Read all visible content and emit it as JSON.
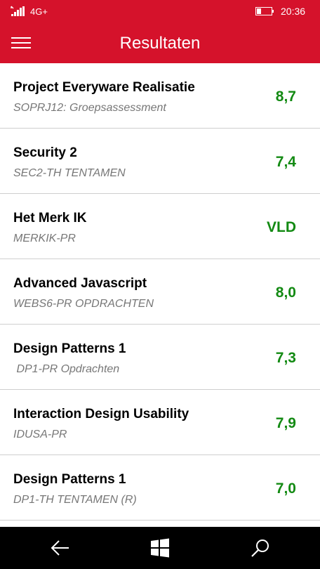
{
  "statusbar": {
    "network": "4G+",
    "time": "20:36"
  },
  "appbar": {
    "title": "Resultaten"
  },
  "results": [
    {
      "name": "Project Everyware Realisatie",
      "code": "SOPRJ12: Groepsassessment",
      "grade": "8,7"
    },
    {
      "name": "Security 2",
      "code": "SEC2-TH TENTAMEN",
      "grade": "7,4"
    },
    {
      "name": "Het Merk IK",
      "code": "MERKIK-PR",
      "grade": "VLD"
    },
    {
      "name": "Advanced Javascript",
      "code": "WEBS6-PR OPDRACHTEN",
      "grade": "8,0"
    },
    {
      "name": "Design Patterns 1",
      "code": " DP1-PR Opdrachten",
      "grade": "7,3"
    },
    {
      "name": "Interaction Design Usability",
      "code": "IDUSA-PR",
      "grade": "7,9"
    },
    {
      "name": "Design Patterns 1",
      "code": "DP1-TH TENTAMEN (R)",
      "grade": "7,0"
    }
  ],
  "colors": {
    "accent": "#d5122b",
    "grade": "#138a13"
  },
  "icons": {
    "menu": "hamburger-icon",
    "back": "back-arrow-icon",
    "home": "windows-logo-icon",
    "search": "search-icon"
  }
}
